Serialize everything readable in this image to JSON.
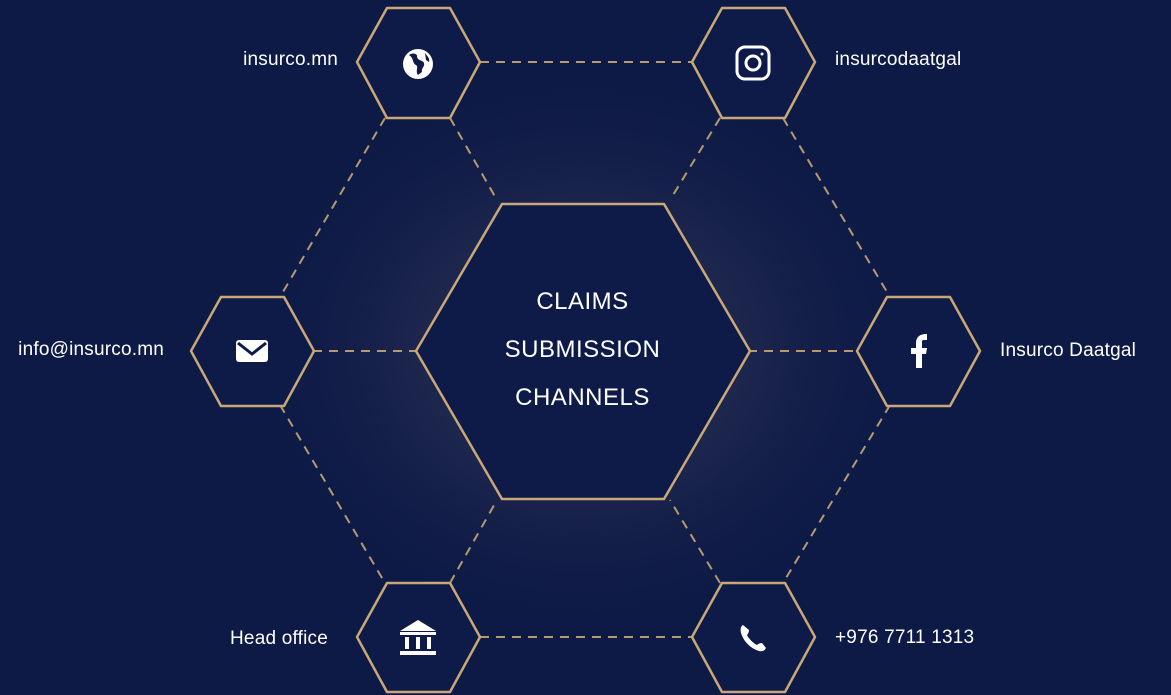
{
  "center": {
    "line1": "CLAIMS",
    "line2": "SUBMISSION",
    "line3": "CHANNELS"
  },
  "channels": {
    "website": {
      "label": "insurco.mn",
      "icon": "globe-icon"
    },
    "instagram": {
      "label": "insurcodaatgal",
      "icon": "instagram-icon"
    },
    "email": {
      "label": "info@insurco.mn",
      "icon": "mail-icon"
    },
    "facebook": {
      "label": "Insurco Daatgal",
      "icon": "facebook-icon"
    },
    "office": {
      "label": "Head office",
      "icon": "bank-icon"
    },
    "phone": {
      "label": "+976 7711 1313",
      "icon": "phone-icon"
    }
  },
  "colors": {
    "background": "#0d1a46",
    "gold": "#c9a776",
    "white": "#ffffff"
  }
}
